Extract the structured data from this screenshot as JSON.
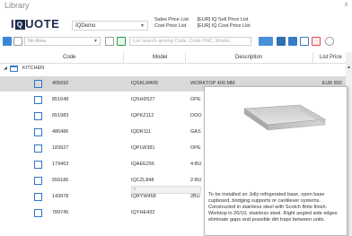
{
  "window": {
    "title": "Library",
    "pin_glyph": "⇳"
  },
  "header": {
    "logo_part1": "I",
    "logo_box": "Q",
    "logo_part2": "UOTE",
    "account_select": "IQDemo",
    "price_lists": [
      {
        "label": "Sales Price List",
        "value": "[EUR] IQ Sell Price List"
      },
      {
        "label": "Cost Price List",
        "value": "[EUR] IQ Cost Price List"
      }
    ]
  },
  "toolbar": {
    "area_combo": "No Area",
    "search_placeholder": "List search among Code, Code PNC, Model..."
  },
  "table": {
    "columns": [
      "Code",
      "Model",
      "Description",
      "List Price"
    ],
    "group": "KITCHEN",
    "rows": [
      {
        "code": "405692",
        "model": "IQSKLM405",
        "description": "WORKTOP 400 MM",
        "price": "EUR 892"
      },
      {
        "code": "851648",
        "model": "IQSHD527",
        "description": "OPE",
        "price": ""
      },
      {
        "code": "651983",
        "model": "IQPKZ112",
        "description": "DOO",
        "price": ""
      },
      {
        "code": "486486",
        "model": "IQDR111",
        "description": "GAS",
        "price": ""
      },
      {
        "code": "183927",
        "model": "IQPLW381",
        "description": "OPE",
        "price": ""
      },
      {
        "code": "179463",
        "model": "IQAEE256",
        "description": "4-BU",
        "price": ""
      },
      {
        "code": "556186",
        "model": "IQCZL848",
        "description": "2-BU",
        "price": ""
      },
      {
        "code": "143978",
        "model": "IQRYW458",
        "description": "2BU",
        "price": ""
      },
      {
        "code": "789745",
        "model": "IQYHE432",
        "description": "",
        "price": ""
      }
    ]
  },
  "tooltip": {
    "text": "To be installed on Jolly refrigerated base, open base cupboard, bridging supports or cantilever systems. Constructed in stainless steel with Scotch Brite finish. Worktop in 20/10, stainless steel. Right angled side edges eliminate gaps and possible dirt traps between units."
  },
  "colors": {
    "accent": "#2f78c4",
    "selected_row": "#d9d9d9",
    "logo": "#1a2b4c"
  }
}
